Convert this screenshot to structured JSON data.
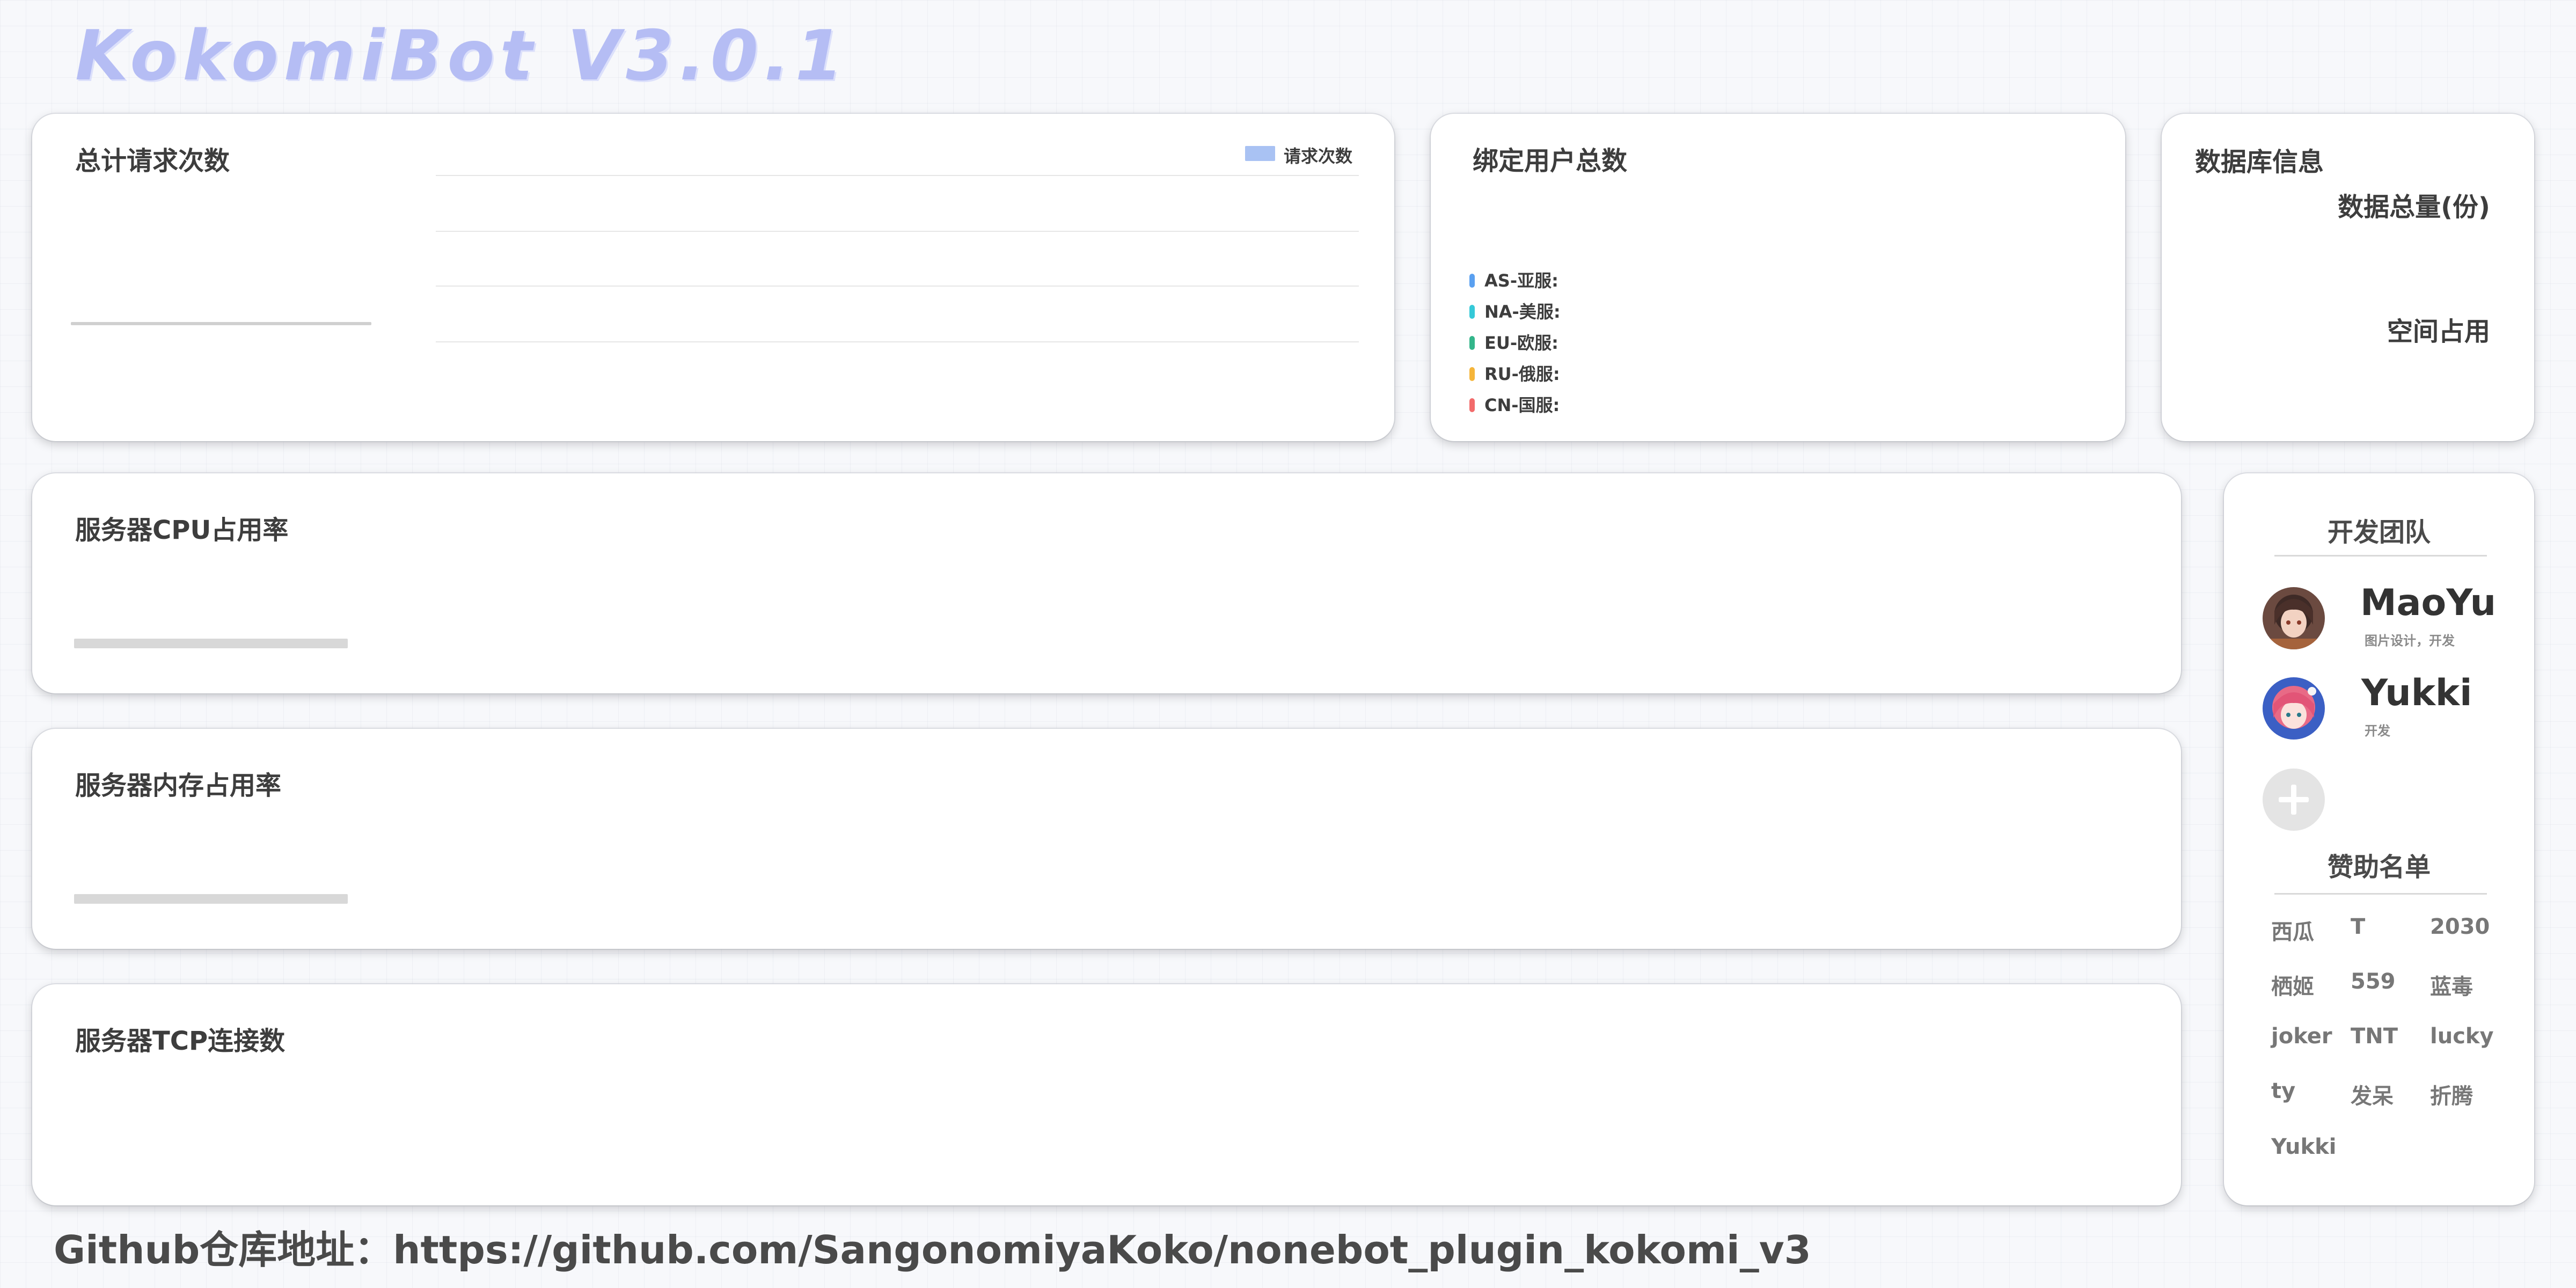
{
  "app": {
    "title": "KokomiBot V3.0.1"
  },
  "requests_card": {
    "title": "总计请求次数",
    "legend_label": "请求次数",
    "legend_color": "#a9c2f3"
  },
  "users_card": {
    "title": "绑定用户总数",
    "servers": [
      {
        "label": "AS-亚服:",
        "color": "#5aa0f0"
      },
      {
        "label": "NA-美服:",
        "color": "#35c9d8"
      },
      {
        "label": "EU-欧服:",
        "color": "#33b58a"
      },
      {
        "label": "RU-俄服:",
        "color": "#f5b53a"
      },
      {
        "label": "CN-国服:",
        "color": "#f26b6b"
      }
    ]
  },
  "database_card": {
    "title": "数据库信息",
    "total_label": "数据总量(份)",
    "space_label": "空间占用"
  },
  "cpu_card": {
    "title": "服务器CPU占用率"
  },
  "memory_card": {
    "title": "服务器内存占用率"
  },
  "tcp_card": {
    "title": "服务器TCP连接数"
  },
  "team": {
    "heading": "开发团队",
    "members": [
      {
        "name": "MaoYu",
        "role": "图片设计，开发"
      },
      {
        "name": "Yukki",
        "role": "开发"
      }
    ],
    "add_icon": "plus-icon"
  },
  "sponsors": {
    "heading": "赞助名单",
    "names": [
      "西瓜",
      "T",
      "2030",
      "栖姬",
      "559",
      "蓝毒",
      "joker",
      "TNT",
      "lucky",
      "ty",
      "发呆",
      "折腾",
      "Yukki"
    ]
  },
  "footer": {
    "text": "Github仓库地址：https://github.com/SangonomiyaKoko/nonebot_plugin_kokomi_v3"
  }
}
